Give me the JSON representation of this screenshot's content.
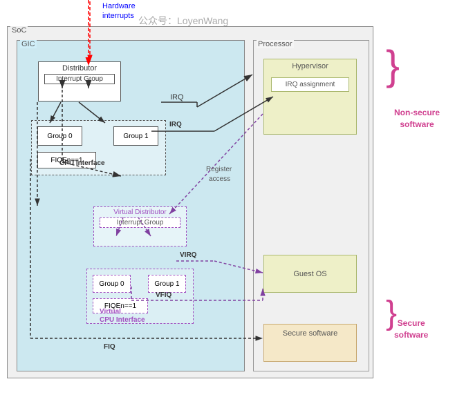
{
  "watermark": "公众号：LoyenWang",
  "hw_interrupts_label": "Hardware\ninterrupts",
  "soc_label": "SoC",
  "gic_label": "GIC",
  "processor_label": "Processor",
  "distributor_label": "Distributor",
  "interrupt_group_label": "Interrupt Group",
  "cpu_interface_label": "CPU Interface",
  "group0_label": "Group 0",
  "group1_label": "Group 1",
  "fiqen_label": "FIQEn==1",
  "vdist_label": "Virtual Distributor",
  "vinterrupt_group_label": "Interrupt Group",
  "vcpu_interface_label": "Virtual\nCPU Interface",
  "vgroup0_label": "Group 0",
  "vgroup1_label": "Group 1",
  "vfiqen_label": "FIQEn==1",
  "hypervisor_label": "Hypervisor",
  "irq_assignment_label": "IRQ\nassignment",
  "guestos_label": "Guest OS",
  "secure_sw_label": "Secure\nsoftware",
  "non_secure_label": "Non-secure\nsoftware",
  "secure_label": "Secure\nsoftware",
  "irq_text": "IRQ",
  "virq_text": "VIRQ",
  "vfiq_text": "VFIQ",
  "fiq_text": "FIQ",
  "register_access_text": "Register\naccess"
}
